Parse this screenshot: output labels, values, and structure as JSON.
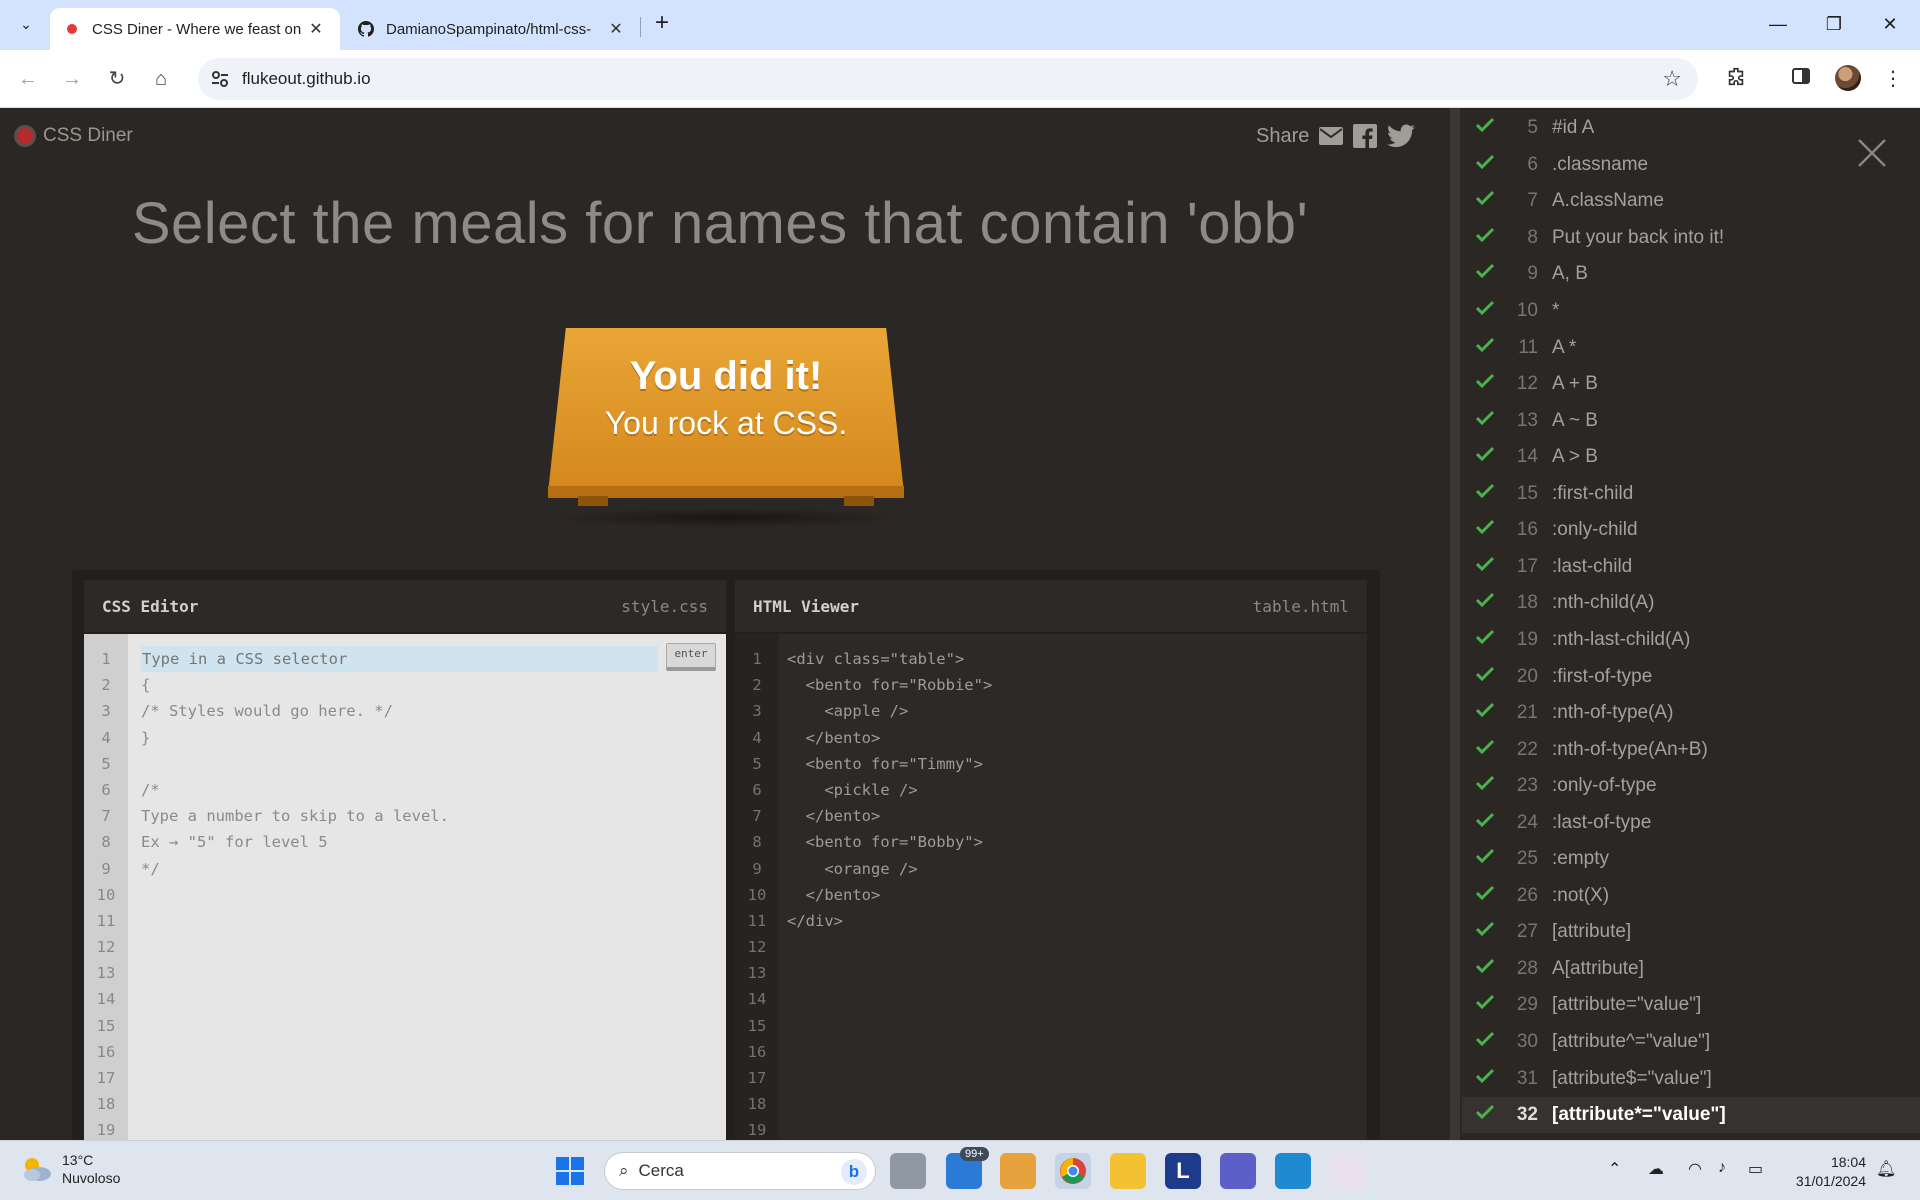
{
  "browser": {
    "tabs": [
      {
        "title": "CSS Diner - Where we feast on (",
        "active": true
      },
      {
        "title": "DamianoSpampinato/html-css-",
        "active": false
      }
    ],
    "url": "flukeout.github.io"
  },
  "game": {
    "logo": "CSS Diner",
    "share_label": "Share",
    "order_text": "Select the meals for names that contain 'obb'",
    "table_line1": "You did it!",
    "table_line2": "You rock at CSS."
  },
  "css_editor": {
    "title": "CSS Editor",
    "filename": "style.css",
    "placeholder": "Type in a CSS selector",
    "enter_label": "enter",
    "lines": [
      "",
      "{",
      "/* Styles would go here. */",
      "}",
      "",
      "/*",
      "Type a number to skip to a level.",
      "Ex → \"5\" for level 5",
      "*/",
      "",
      "",
      "",
      "",
      "",
      "",
      "",
      "",
      "",
      ""
    ],
    "line_numbers": [
      "1",
      "2",
      "3",
      "4",
      "5",
      "6",
      "7",
      "8",
      "9",
      "10",
      "11",
      "12",
      "13",
      "14",
      "15",
      "16",
      "17",
      "18",
      "19"
    ]
  },
  "html_viewer": {
    "title": "HTML Viewer",
    "filename": "table.html",
    "lines": [
      "<div class=\"table\">",
      "  <bento for=\"Robbie\">",
      "    <apple />",
      "  </bento>",
      "  <bento for=\"Timmy\">",
      "    <pickle />",
      "  </bento>",
      "  <bento for=\"Bobby\">",
      "    <orange />",
      "  </bento>",
      "</div>",
      "",
      "",
      "",
      "",
      "",
      "",
      "",
      ""
    ],
    "line_numbers": [
      "1",
      "2",
      "3",
      "4",
      "5",
      "6",
      "7",
      "8",
      "9",
      "10",
      "11",
      "12",
      "13",
      "14",
      "15",
      "16",
      "17",
      "18",
      "19"
    ]
  },
  "levels": [
    {
      "num": "5",
      "name": "#id A"
    },
    {
      "num": "6",
      "name": ".classname"
    },
    {
      "num": "7",
      "name": "A.className"
    },
    {
      "num": "8",
      "name": "Put your back into it!"
    },
    {
      "num": "9",
      "name": "A, B"
    },
    {
      "num": "10",
      "name": "*"
    },
    {
      "num": "11",
      "name": "A *"
    },
    {
      "num": "12",
      "name": "A + B"
    },
    {
      "num": "13",
      "name": "A ~ B"
    },
    {
      "num": "14",
      "name": "A > B"
    },
    {
      "num": "15",
      "name": ":first-child"
    },
    {
      "num": "16",
      "name": ":only-child"
    },
    {
      "num": "17",
      "name": ":last-child"
    },
    {
      "num": "18",
      "name": ":nth-child(A)"
    },
    {
      "num": "19",
      "name": ":nth-last-child(A)"
    },
    {
      "num": "20",
      "name": ":first-of-type"
    },
    {
      "num": "21",
      "name": ":nth-of-type(A)"
    },
    {
      "num": "22",
      "name": ":nth-of-type(An+B)"
    },
    {
      "num": "23",
      "name": ":only-of-type"
    },
    {
      "num": "24",
      "name": ":last-of-type"
    },
    {
      "num": "25",
      "name": ":empty"
    },
    {
      "num": "26",
      "name": ":not(X)"
    },
    {
      "num": "27",
      "name": "[attribute]"
    },
    {
      "num": "28",
      "name": "A[attribute]"
    },
    {
      "num": "29",
      "name": "[attribute=\"value\"]"
    },
    {
      "num": "30",
      "name": "[attribute^=\"value\"]"
    },
    {
      "num": "31",
      "name": "[attribute$=\"value\"]"
    },
    {
      "num": "32",
      "name": "[attribute*=\"value\"]",
      "current": true
    }
  ],
  "taskbar": {
    "temperature": "13°C",
    "weather": "Nuvoloso",
    "search_placeholder": "Cerca",
    "mail_badge": "99+",
    "time": "18:04",
    "date": "31/01/2024"
  },
  "colors": {
    "check": "#4caf50",
    "table": "#e09a2c",
    "selector_highlight": "#cfe4ef"
  }
}
